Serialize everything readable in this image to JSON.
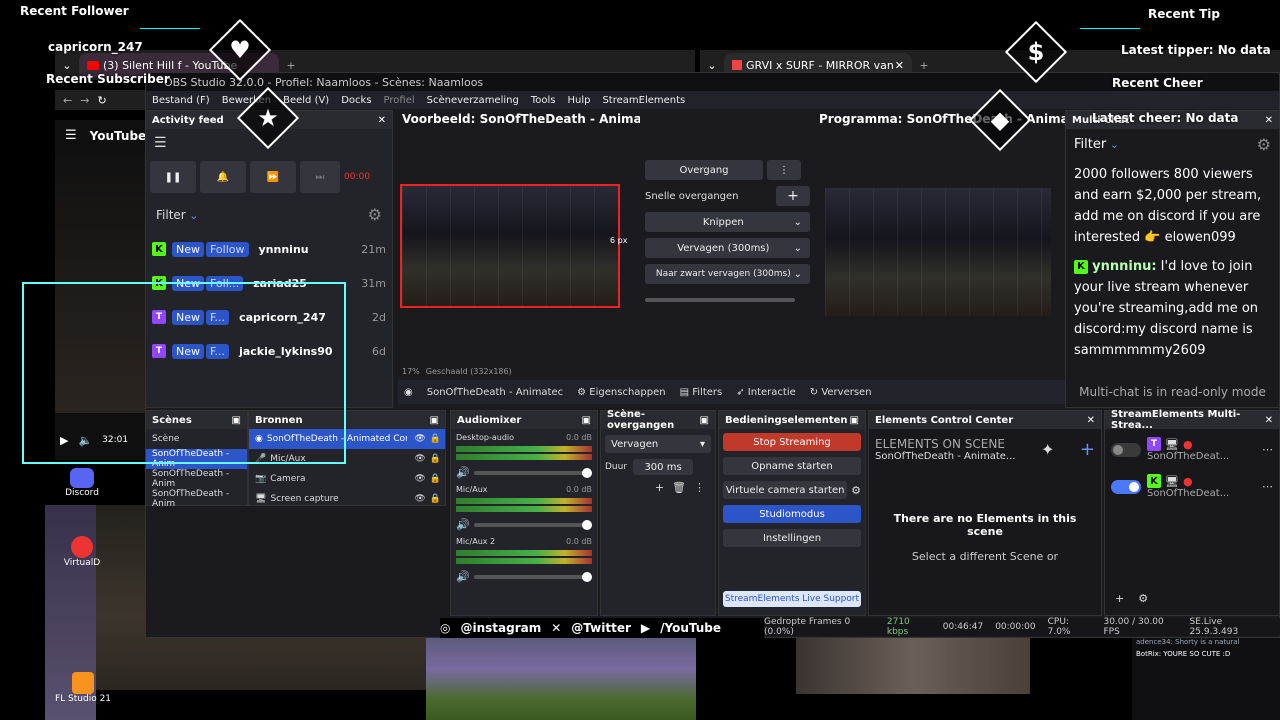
{
  "overlay": {
    "recent_follower_title": "Recent Follower",
    "recent_follower_value": "capricorn_247",
    "recent_subscriber_title": "Recent Subscriber",
    "recent_tip_title": "Recent Tip",
    "latest_tipper": "Latest tipper: No data",
    "recent_cheer_title": "Recent Cheer",
    "latest_cheer": "Latest cheer: No data",
    "socials": [
      "@instagram",
      "@Twitter",
      "/YouTube"
    ],
    "chat_snippets": [
      "adence34: Shorty is a natural",
      "BotRix: YOURE SO CUTE :D"
    ],
    "desktop_icons": [
      "Discord",
      "VirtualD",
      "FL Studio 21"
    ]
  },
  "browser": {
    "tab_left": "(3) Silent Hill f - YouTube",
    "tab_right": "GRVI x SURF - MIRROR van",
    "youtube_label": "YouTube",
    "video_time": "32:01"
  },
  "obs": {
    "title": "OBS Studio 32.0.0 - Profiel: Naamloos - Scènes: Naamloos",
    "menu": [
      "Bestand (F)",
      "Bewerken",
      "Beeld (V)",
      "Docks",
      "Profiel",
      "Scèneverzameling",
      "Tools",
      "Hulp",
      "StreamElements"
    ],
    "preview_title": "Voorbeeld: SonOfTheDeath - Animat",
    "program_title": "Programma: SonOfTheDeath - Anima",
    "preview_zoom": "17%",
    "preview_scale": "Geschaald (332x186)",
    "preview_px": "6 px",
    "transition": {
      "label": "Overgang",
      "quick": "Snelle overgangen",
      "cut": "Knippen",
      "fade": "Vervagen (300ms)",
      "fade_black": "Naar zwart vervagen (300ms)"
    },
    "source_toolbar": {
      "source": "SonOfTheDeath - Animatec",
      "properties": "Eigenschappen",
      "filters": "Filters",
      "interaction": "Interactie",
      "refresh": "Verversen"
    },
    "activity": {
      "title": "Activity feed",
      "filter": "Filter",
      "timer": "00:00",
      "rows": [
        {
          "platform": "K",
          "new": "New",
          "type": "Follow",
          "user": "ynnninu",
          "time": "21m"
        },
        {
          "platform": "K",
          "new": "New",
          "type": "Foll...",
          "user": "zariad25",
          "time": "31m"
        },
        {
          "platform": "T",
          "new": "New",
          "type": "F...",
          "user": "capricorn_247",
          "time": "2d"
        },
        {
          "platform": "T",
          "new": "New",
          "type": "F...",
          "user": "jackie_lykins90",
          "time": "6d"
        }
      ]
    },
    "scenes": {
      "title": "Scènes",
      "items": [
        "Scène",
        "SonOfTheDeath - Anim",
        "SonOfTheDeath - Anim",
        "SonOfTheDeath - Anim"
      ]
    },
    "sources": {
      "title": "Bronnen",
      "items": [
        "SonOfTheDeath - Animated Conne",
        "Mic/Aux",
        "Camera",
        "Screen capture"
      ]
    },
    "mixer": {
      "title": "Audiomixer",
      "channels": [
        {
          "name": "Desktop-audio",
          "db": "0.0 dB"
        },
        {
          "name": "Mic/Aux",
          "db": "0.0 dB"
        },
        {
          "name": "Mic/Aux 2",
          "db": "0.0 dB"
        }
      ]
    },
    "scene_transitions": {
      "title": "Scène-overgangen",
      "value": "Vervagen",
      "duration_label": "Duur",
      "duration": "300 ms"
    },
    "controls": {
      "title": "Bedieningselementen",
      "stop_streaming": "Stop Streaming",
      "record": "Opname starten",
      "virtual_cam": "Virtuele camera starten",
      "studio": "Studiomodus",
      "settings": "Instellingen",
      "support": "StreamElements Live Support"
    },
    "ecc": {
      "title": "Elements Control Center",
      "header": "ELEMENTS ON SCENE",
      "scene": "SonOfTheDeath - Animate...",
      "empty_title": "There are no Elements in this scene",
      "empty_sub": "Select a different Scene or"
    },
    "multistream": {
      "title": "StreamElements Multi-Strea...",
      "rows": [
        {
          "name": "SonOfTheDeat..."
        },
        {
          "name": "SonOfTheDeat..."
        }
      ]
    },
    "chat": {
      "title": "Multi-chat",
      "filter": "Filter",
      "message1": "2000 followers 800 viewers and earn $2,000 per stream, add me on discord if you are interested 👉 elowen099",
      "message2_user": "ynnninu:",
      "message2_text": " I'd love to join your live stream whenever you're streaming,add me on discord:my discord name is sammmmmmy2609",
      "readonly": "Multi-chat is in read-only mode"
    },
    "status": {
      "dropped": "Gedropte Frames 0 (0.0%)",
      "kbps": "2710 kbps",
      "live_time": "00:46:47",
      "rec_time": "00:00:00",
      "cpu": "CPU: 7.0%",
      "fps": "30.00 / 30.00 FPS",
      "version": "SE.Live 25.9.3.493"
    }
  },
  "colors": {
    "accent": "#2b55c9",
    "stop": "#c0392b",
    "kick": "#53fc18",
    "twitch": "#9146ff"
  }
}
